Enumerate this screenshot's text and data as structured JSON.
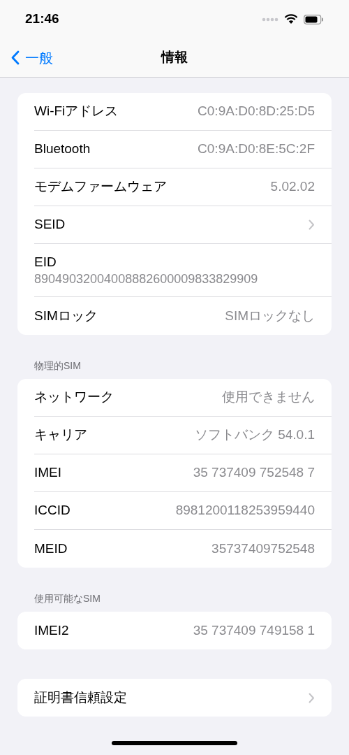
{
  "status_bar": {
    "time": "21:46"
  },
  "nav": {
    "back": "一般",
    "title": "情報"
  },
  "sections": [
    {
      "rows": [
        {
          "kind": "value",
          "label": "Wi-Fiアドレス",
          "value": "C0:9A:D0:8D:25:D5"
        },
        {
          "kind": "value",
          "label": "Bluetooth",
          "value": "C0:9A:D0:8E:5C:2F"
        },
        {
          "kind": "value",
          "label": "モデムファームウェア",
          "value": "5.02.02"
        },
        {
          "kind": "chevron",
          "label": "SEID"
        },
        {
          "kind": "stacked",
          "label": "EID",
          "value": "89049032004008882600009833829909"
        },
        {
          "kind": "value",
          "label": "SIMロック",
          "value": "SIMロックなし"
        }
      ]
    },
    {
      "header": "物理的SIM",
      "rows": [
        {
          "kind": "value",
          "label": "ネットワーク",
          "value": "使用できません"
        },
        {
          "kind": "value",
          "label": "キャリア",
          "value": "ソフトバンク 54.0.1"
        },
        {
          "kind": "value",
          "label": "IMEI",
          "value": "35 737409 752548 7"
        },
        {
          "kind": "value",
          "label": "ICCID",
          "value": "8981200118253959440"
        },
        {
          "kind": "value",
          "label": "MEID",
          "value": "35737409752548"
        }
      ]
    },
    {
      "header": "使用可能なSIM",
      "rows": [
        {
          "kind": "value",
          "label": "IMEI2",
          "value": "35 737409 749158 1"
        }
      ]
    },
    {
      "rows": [
        {
          "kind": "chevron",
          "label": "証明書信頼設定"
        }
      ]
    }
  ]
}
